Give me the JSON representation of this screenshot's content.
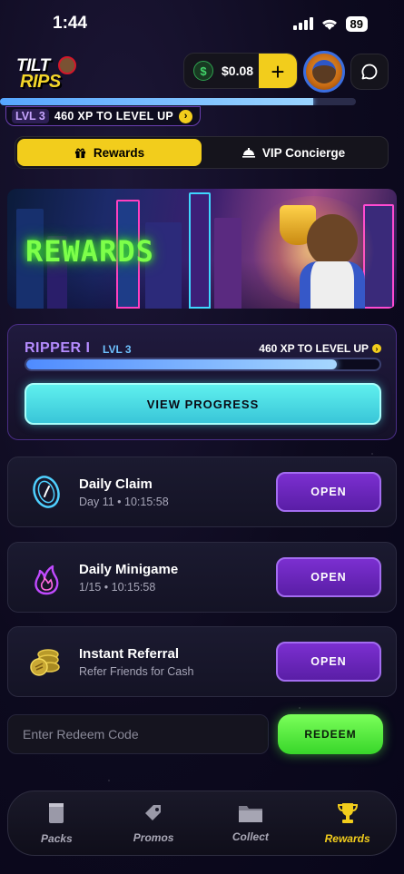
{
  "status_bar": {
    "time": "1:44",
    "battery": "89"
  },
  "header": {
    "logo_line1": "TILT",
    "logo_line2": "RIPS",
    "balance": "$0.08",
    "currency_symbol": "$",
    "add_label": "+"
  },
  "xp": {
    "progress": 0.88,
    "level_label": "LVL 3",
    "xp_text": "460  XP TO LEVEL UP",
    "chevron": "›"
  },
  "tabs": [
    {
      "label": "Rewards",
      "icon": "gift-icon",
      "active": true
    },
    {
      "label": "VIP Concierge",
      "icon": "concierge-icon",
      "active": false
    }
  ],
  "banner": {
    "title": "REWARDS"
  },
  "level_card": {
    "rank": "RIPPER I",
    "level": "LVL 3",
    "xp_text": "460 XP TO LEVEL UP",
    "chevron": "›",
    "progress": 0.88,
    "button_label": "VIEW PROGRESS"
  },
  "rewards": [
    {
      "title": "Daily Claim",
      "subtitle": "Day 11 • 10:15:58",
      "button": "OPEN",
      "icon": "clock-coin-icon"
    },
    {
      "title": "Daily Minigame",
      "subtitle": "1/15 • 10:15:58",
      "button": "OPEN",
      "icon": "flame-icon"
    },
    {
      "title": "Instant Referral",
      "subtitle": "Refer Friends for Cash",
      "button": "OPEN",
      "icon": "coins-icon"
    }
  ],
  "redeem": {
    "placeholder": "Enter Redeem Code",
    "button_label": "REDEEM"
  },
  "nav": [
    {
      "label": "Packs",
      "icon": "pack-icon",
      "active": false
    },
    {
      "label": "Promos",
      "icon": "tag-icon",
      "active": false
    },
    {
      "label": "Collect",
      "icon": "folder-icon",
      "active": false
    },
    {
      "label": "Rewards",
      "icon": "trophy-icon",
      "active": true
    }
  ],
  "colors": {
    "accent_yellow": "#f2cd1c",
    "open_purple": "#6a24bb",
    "progress_cyan": "#4ae0e8",
    "redeem_green": "#5cf040",
    "rank_purple": "#b58cff"
  }
}
